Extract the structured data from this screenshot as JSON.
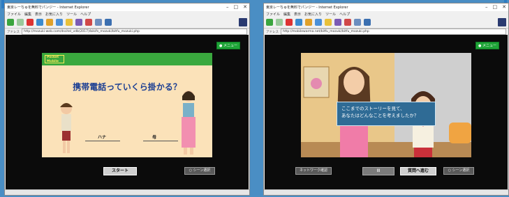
{
  "windows": [
    {
      "title": "東京レーちゅを無料でパンジー - Internet Explorer",
      "menu": [
        "ファイル",
        "編集",
        "表示",
        "お気に入り",
        "ツール",
        "ヘルプ"
      ],
      "address_label": "アドレス",
      "url": "http://mozuki-web.com/dscitel_vdb(2017)/bikifs_mozuki/bitfu_mozuki.php",
      "corner_button": "● メニュー",
      "scene": {
        "logo": "Pocket\nMobile",
        "question": "携帯電話っていくら掛かる？",
        "label_left": "ハナ",
        "label_right": "母"
      },
      "buttons": {
        "start": "スタート",
        "right": "○ シーン選択"
      }
    },
    {
      "title": "東京レーちゅを無料でパンジー - Internet Explorer",
      "menu": [
        "ファイル",
        "編集",
        "表示",
        "お気に入り",
        "ツール",
        "ヘルプ"
      ],
      "address_label": "アドレス",
      "url": "http://mobilewarma.net/bitfu_mozuki/bitfu_mozuki.php",
      "corner_button": "● メニュー",
      "scene": {
        "message_line1": "ここまでのストーリーを見て、",
        "message_line2": "あなたはどんなことを考えましたか？"
      },
      "buttons": {
        "back": "ネットワーク確認",
        "pause": "II",
        "next": "質問へ進む",
        "right": "○ シーン選択"
      }
    }
  ],
  "colors": {
    "background": "#4a8ec4",
    "green": "#1fa438",
    "question": "#1c3f93",
    "message": "#2f6b95"
  },
  "icons": [
    "back-icon",
    "forward-icon",
    "stop-icon",
    "refresh-icon",
    "home-icon",
    "search-icon",
    "favorites-icon",
    "history-icon",
    "mail-icon",
    "print-icon",
    "edit-icon"
  ]
}
